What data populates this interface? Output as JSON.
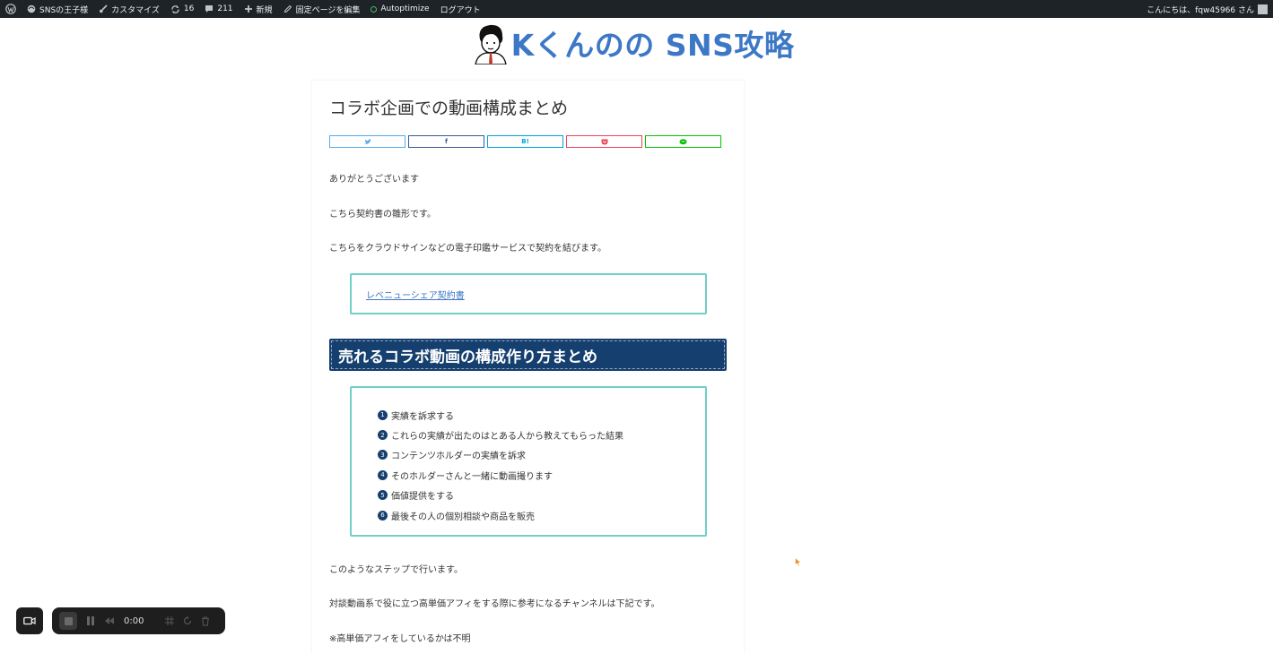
{
  "admin_bar": {
    "site_name": "SNSの王子様",
    "customize": "カスタマイズ",
    "updates_count": "16",
    "comments_count": "211",
    "new": "新規",
    "edit_page": "固定ページを編集",
    "autoptimize": "Autoptimize",
    "logout": "ログアウト",
    "greeting": "こんにちは、fqw45966 さん"
  },
  "site": {
    "logo_text": "Kくんのの SNS攻略"
  },
  "article": {
    "title": "コラボ企画での動画構成まとめ",
    "share_buttons": [
      "twitter-icon",
      "facebook-icon",
      "hatena-icon",
      "pocket-icon",
      "line-icon"
    ],
    "share_hatena_label": "B!",
    "share_facebook_label": "f",
    "para1": "ありがとうございます",
    "para2": "こちら契約書の雛形です。",
    "para3": "こちらをクラウドサインなどの電子印鑑サービスで契約を結びます。",
    "contract_link": "レベニューシェア契約書",
    "section_heading": "売れるコラボ動画の構成作り方まとめ",
    "steps": [
      {
        "num": "1",
        "text": "実績を訴求する"
      },
      {
        "num": "2",
        "text": "これらの実績が出たのはとある人から教えてもらった結果"
      },
      {
        "num": "3",
        "text": "コンテンツホルダーの実績を訴求"
      },
      {
        "num": "4",
        "text": "そのホルダーさんと一緒に動画撮ります"
      },
      {
        "num": "5",
        "text": "価値提供をする"
      },
      {
        "num": "6",
        "text": "最後その人の個別相談や商品を販売"
      }
    ],
    "para4": "このようなステップで行います。",
    "para5": "対談動画系で役に立つ高単価アフィをする際に参考になるチャンネルは下記です。",
    "para6": "※高単価アフィをしているかは不明"
  },
  "recorder": {
    "time": "0:00"
  },
  "colors": {
    "admin_bg": "#1d2327",
    "logo": "#3d78c6",
    "heading_bg": "#153f6e",
    "box_border": "#6fd0c7"
  }
}
